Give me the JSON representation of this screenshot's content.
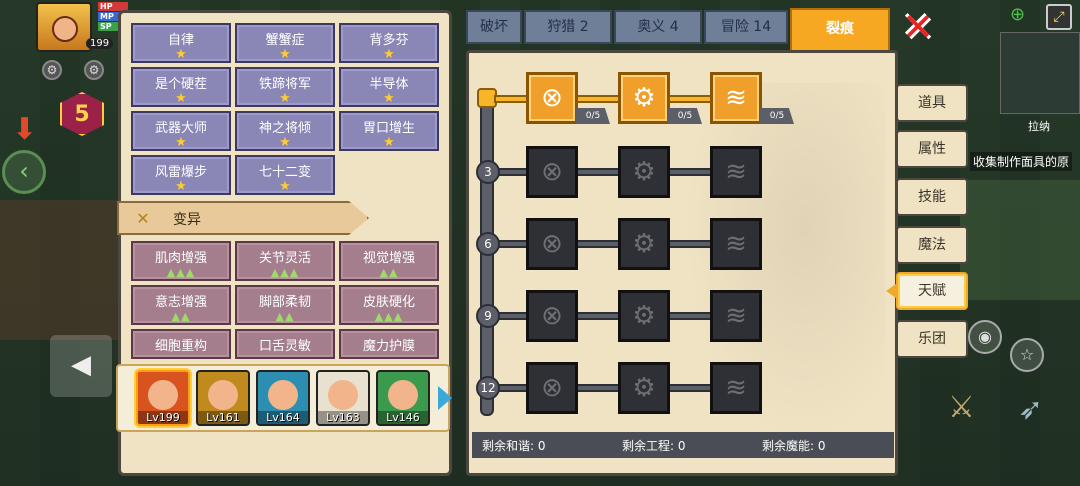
{
  "hud": {
    "level": "199",
    "bars": [
      "HP",
      "MP",
      "SP"
    ],
    "badge": "5"
  },
  "skills": [
    {
      "name": "自律",
      "stars": "★"
    },
    {
      "name": "蟹蟹症",
      "stars": "★"
    },
    {
      "name": "背多芬",
      "stars": "★"
    },
    {
      "name": "是个硬茬",
      "stars": "★"
    },
    {
      "name": "铁蹄将军",
      "stars": "★"
    },
    {
      "name": "半导体",
      "stars": "★"
    },
    {
      "name": "武器大师",
      "stars": "★"
    },
    {
      "name": "神之将倾",
      "stars": "★"
    },
    {
      "name": "胃口增生",
      "stars": "★"
    },
    {
      "name": "风雷爆步",
      "stars": "★"
    },
    {
      "name": "七十二变",
      "stars": "★"
    }
  ],
  "mutation": {
    "title": "变异",
    "items": [
      {
        "name": "肌肉增强",
        "tris": "▲▲▲"
      },
      {
        "name": "关节灵活",
        "tris": "▲▲▲"
      },
      {
        "name": "视觉增强",
        "tris": "▲▲"
      },
      {
        "name": "意志增强",
        "tris": "▲▲"
      },
      {
        "name": "脚部柔韧",
        "tris": "▲▲"
      },
      {
        "name": "皮肤硬化",
        "tris": "▲▲▲"
      },
      {
        "name": "细胞重构",
        "tris": "▲▲"
      },
      {
        "name": "口舌灵敏",
        "tris": "▲▲"
      },
      {
        "name": "魔力护膜",
        "tris": "▲▲"
      }
    ]
  },
  "characters": [
    {
      "lv": "Lv199",
      "color": "#d8541e",
      "selected": true
    },
    {
      "lv": "Lv161",
      "color": "#c08a1e",
      "selected": false
    },
    {
      "lv": "Lv164",
      "color": "#2c8fb2",
      "selected": false
    },
    {
      "lv": "Lv163",
      "color": "#e8e1d0",
      "selected": false
    },
    {
      "lv": "Lv146",
      "color": "#3c9a4e",
      "selected": false
    }
  ],
  "tabs": [
    "破坏",
    "狩猎 2",
    "奥义 4",
    "冒险 14",
    "裂痕"
  ],
  "active_tab": "裂痕",
  "talent_tree": {
    "rows": [
      "",
      "3",
      "6",
      "9",
      "12"
    ],
    "first_row_counts": [
      "0/5",
      "0/5",
      "0/5"
    ],
    "node_icons": [
      "harmony-icon",
      "gears-icon",
      "claw-icon"
    ]
  },
  "footer": {
    "harmony": "剩余和谐: 0",
    "engineering": "剩余工程: 0",
    "magic": "剩余魔能: 0"
  },
  "side_menu": [
    "道具",
    "属性",
    "技能",
    "魔法",
    "天赋",
    "乐团"
  ],
  "side_active": "天赋",
  "map": {
    "label": "拉纳",
    "hint": "收集制作面具的原"
  }
}
